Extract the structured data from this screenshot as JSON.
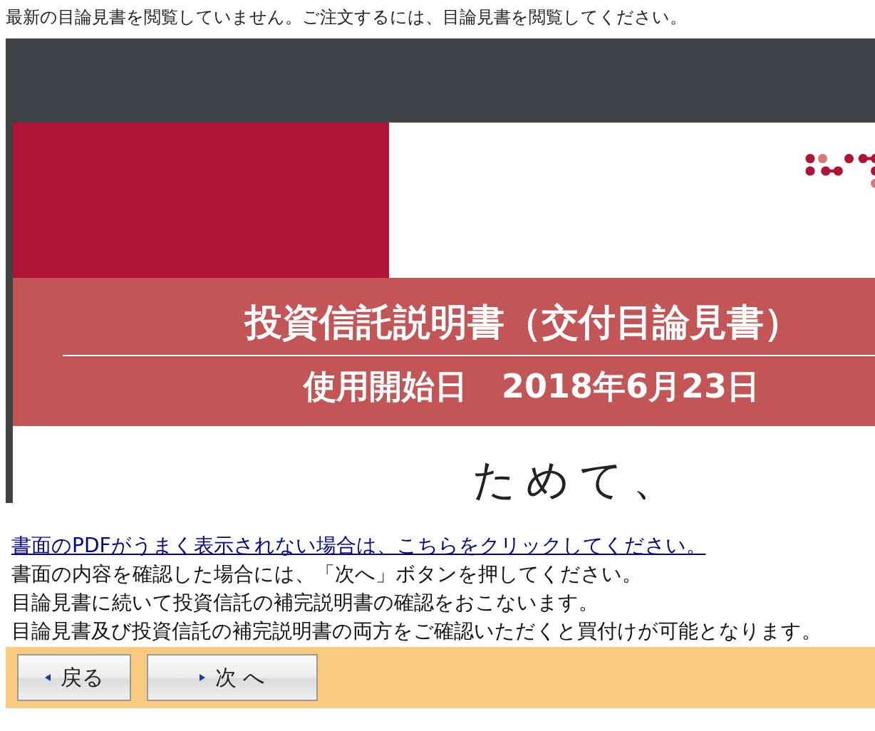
{
  "notice": "最新の目論見書を閲覧していません。ご注文するには、目論見書を閲覧してください。",
  "viewer": {
    "title": "投資信託説明書（交付目論見書）",
    "date_label": "使用開始日",
    "date": "2018年6月23日",
    "body_text": "ためて、"
  },
  "pdf_link": "書面のPDFがうまく表示されない場合は、こちらをクリックしてください。",
  "instructions": [
    "書面の内容を確認した場合には、「次へ」ボタンを押してください。",
    "目論見書に続いて投資信託の補完説明書の確認をおこないます。",
    "目論見書及び投資信託の補完説明書の両方をご確認いただくと買付けが可能となります。"
  ],
  "buttons": [
    {
      "label": "戻る",
      "kind": "back"
    },
    {
      "label": "次 へ",
      "kind": "next"
    }
  ]
}
